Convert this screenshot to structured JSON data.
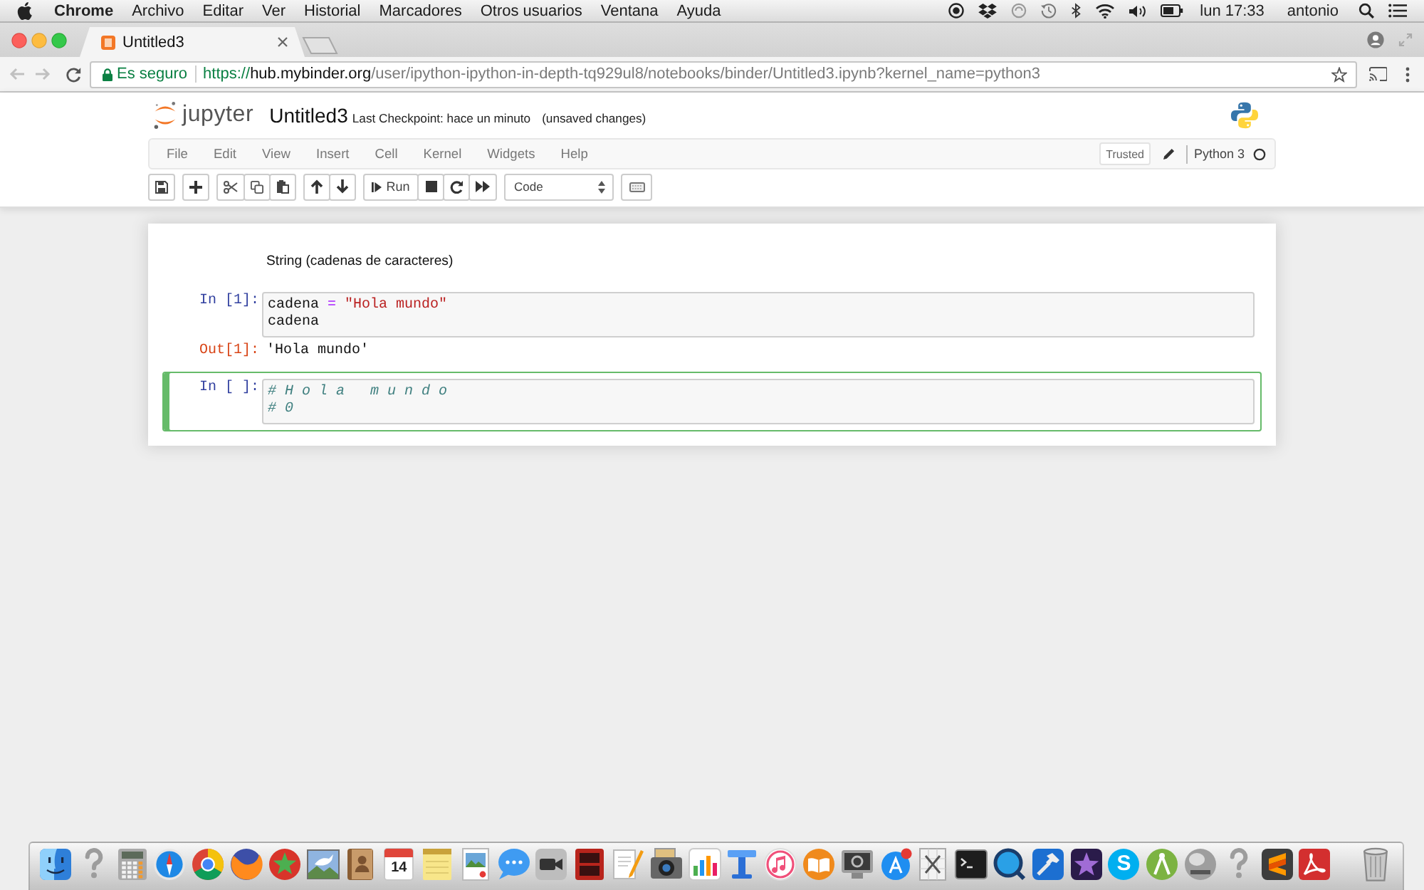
{
  "menu_bar": {
    "app_name": "Chrome",
    "menus": [
      "Archivo",
      "Editar",
      "Ver",
      "Historial",
      "Marcadores",
      "Otros usuarios",
      "Ventana",
      "Ayuda"
    ],
    "clock": "lun 17:33",
    "user": "antonio"
  },
  "browser": {
    "tabs": [
      {
        "title": "Untitled3",
        "selected": true
      }
    ],
    "security_label": "Es seguro",
    "url": {
      "scheme": "https://",
      "host": "hub.mybinder.org",
      "path": "/user/ipython-ipython-in-depth-tq929ul8/notebooks/binder/Untitled3.ipynb?kernel_name=python3"
    }
  },
  "notebook": {
    "logo_text": "jupyter",
    "title": "Untitled3",
    "checkpoint": "Last Checkpoint: hace un minuto",
    "autosave_status": "(unsaved changes)",
    "menus": [
      "File",
      "Edit",
      "View",
      "Insert",
      "Cell",
      "Kernel",
      "Widgets",
      "Help"
    ],
    "trusted_label": "Trusted",
    "kernel_name": "Python 3",
    "kernel_busy": false,
    "toolbar": {
      "run_label": "Run",
      "cell_type": "Code"
    },
    "cells": [
      {
        "kind": "markdown",
        "selected": false,
        "text": "String (cadenas de caracteres)"
      },
      {
        "kind": "code",
        "selected": false,
        "prompt": "In [1]:",
        "lines": [
          {
            "tokens": [
              {
                "kind": "name",
                "text": "cadena"
              },
              {
                "kind": "operator",
                "text": "="
              },
              {
                "kind": "string",
                "text": "\"Hola mundo\""
              }
            ]
          },
          {
            "tokens": [
              {
                "kind": "name",
                "text": "cadena"
              }
            ]
          }
        ],
        "output": {
          "prompt": "Out[1]:",
          "text": "'Hola mundo'"
        }
      },
      {
        "kind": "code",
        "selected": true,
        "prompt": "In [ ]:",
        "lines": [
          {
            "tokens": [
              {
                "kind": "comment",
                "text": "# H o l a   m u n d o"
              }
            ]
          },
          {
            "tokens": [
              {
                "kind": "comment",
                "text": "# 0"
              }
            ]
          }
        ]
      }
    ]
  },
  "dock": {
    "calendar_day": "14",
    "letter_tile": "S"
  }
}
